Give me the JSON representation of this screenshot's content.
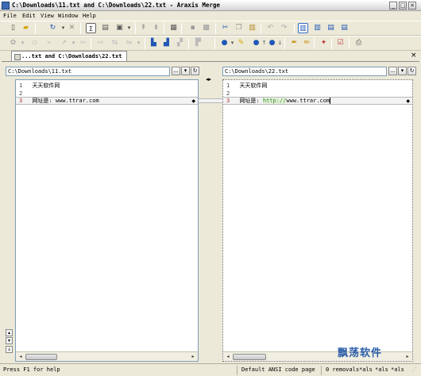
{
  "window": {
    "title": "C:\\Downloads\\11.txt and C:\\Downloads\\22.txt - Araxis Merge",
    "controls": {
      "minimize": "_",
      "maximize": "□",
      "close": "✕"
    }
  },
  "menu": {
    "items": [
      "File",
      "Edit",
      "View",
      "Window",
      "Help"
    ]
  },
  "toolbar1_icons": [
    "new-icon",
    "open-icon",
    "refresh-icon",
    "close-icon",
    "sigma-icon",
    "report-icon",
    "dropdown-icon",
    "prev-change-icon",
    "next-change-icon",
    "doc-icon",
    "save-icon",
    "save-all-icon",
    "cut-icon",
    "copy-icon",
    "paste-icon",
    "undo-icon",
    "redo-icon",
    "layout-two-icon",
    "layout-split-icon",
    "layout-three-icon",
    "layout-list-icon"
  ],
  "toolbar2_icons": [
    "nav-icon",
    "blank-icon",
    "link-icon",
    "arrow-icon",
    "copy-left-icon",
    "copy-right-icon",
    "merge-icon",
    "compare-icon",
    "bookmark-icon",
    "insert-icon",
    "delete-icon",
    "edit-icon",
    "bucket-icon",
    "brush-icon",
    "bullet-up-icon",
    "bullet-down-icon",
    "pen-icon",
    "pencil-icon",
    "wand-icon",
    "checklist-icon",
    "print-icon"
  ],
  "tab": {
    "label": "...txt and C:\\Downloads\\22.txt",
    "close": "×"
  },
  "left": {
    "path": "C:\\Downloads\\11.txt",
    "buttons": [
      "...",
      "▾",
      "↻"
    ],
    "lines": [
      {
        "num": "1",
        "text": "天天软件网"
      },
      {
        "num": "2",
        "text": ""
      },
      {
        "num": "3",
        "text": "网址是: www.ttrar.com"
      }
    ]
  },
  "right": {
    "path": "C:\\Downloads\\22.txt",
    "buttons": [
      "...",
      "▾",
      "↻"
    ],
    "lines": [
      {
        "num": "1",
        "text": "天天软件网"
      },
      {
        "num": "2",
        "text": ""
      },
      {
        "num": "3",
        "text_prefix": "网址是: ",
        "text_inserted": "http://",
        "text_suffix": "www.ttrar.com"
      }
    ]
  },
  "swap_glyph": "◂▸",
  "status": {
    "help": "Press F1 for help",
    "encoding": "Default ANSI code page",
    "removals": "0 removals",
    "cols": [
      "*als",
      "*als",
      "*als"
    ]
  },
  "watermark": "飘荡软件",
  "colors": {
    "accent": "#316ac5",
    "changed_line": "#f3f3f3",
    "inserted_text": "#3a8a2a"
  }
}
